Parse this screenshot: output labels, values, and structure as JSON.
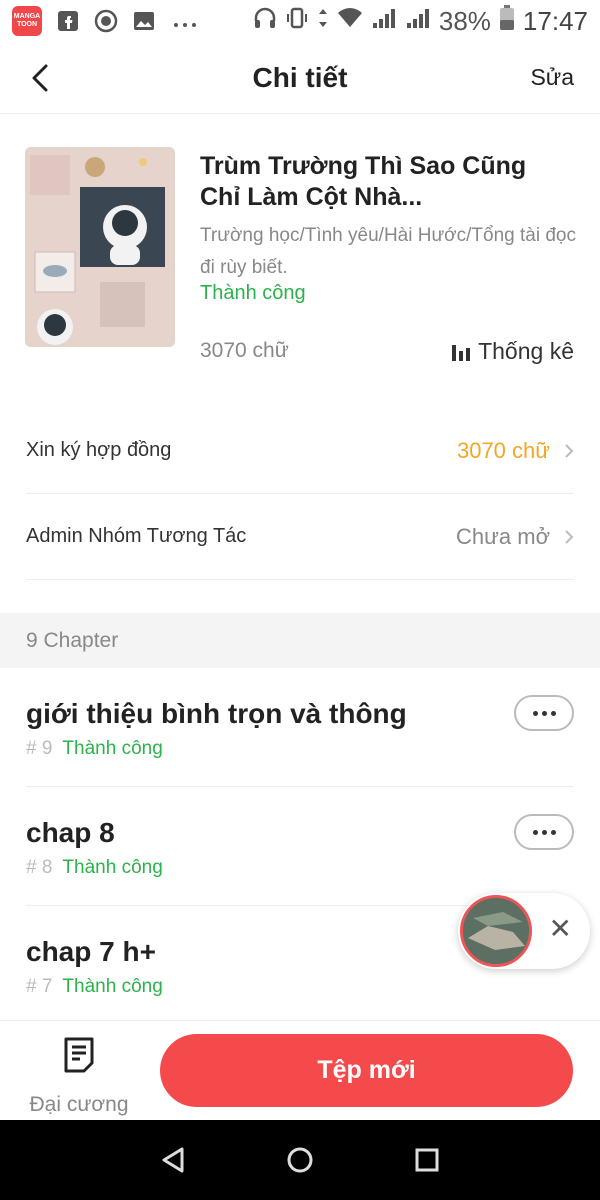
{
  "status_bar": {
    "app_logo_lines": [
      "MANGA",
      "TOON"
    ],
    "battery_pct": "38%",
    "time": "17:47",
    "icons": [
      "mangatoon-logo-icon",
      "facebook-icon",
      "record-icon",
      "image-icon",
      "more-icon",
      "headphones-icon",
      "vibrate-icon",
      "data-arrows-icon",
      "wifi-icon",
      "signal-icon",
      "signal-icon",
      "battery-icon"
    ]
  },
  "nav": {
    "title": "Chi tiết",
    "edit_label": "Sửa"
  },
  "book": {
    "title": "Trùm Trường Thì Sao Cũng Chỉ Làm Cột Nhà...",
    "tags": "Trường học/Tình yêu/Hài Hước/Tổng tài đọc đi rùy biết.",
    "status": "Thành công",
    "word_count": "3070 chữ",
    "stats_label": "Thống kê"
  },
  "settings": [
    {
      "label": "Xin ký hợp đồng",
      "value": "3070 chữ"
    },
    {
      "label": "Admin Nhóm Tương Tác",
      "value": "Chưa mở"
    }
  ],
  "chapters_header": "9 Chapter",
  "chapters": [
    {
      "title": "giới thiệu bình trọn và thông",
      "number": "# 9",
      "status": "Thành công"
    },
    {
      "title": "chap 8",
      "number": "# 8",
      "status": "Thành công"
    },
    {
      "title": "chap 7 h+",
      "number": "# 7",
      "status": "Thành công"
    }
  ],
  "bottom": {
    "outline_label": "Đại cương",
    "new_file_label": "Tệp mới"
  },
  "colors": {
    "accent_red": "#f54a4c",
    "success_green": "#2bb34b",
    "orange_value": "#f5a623"
  }
}
